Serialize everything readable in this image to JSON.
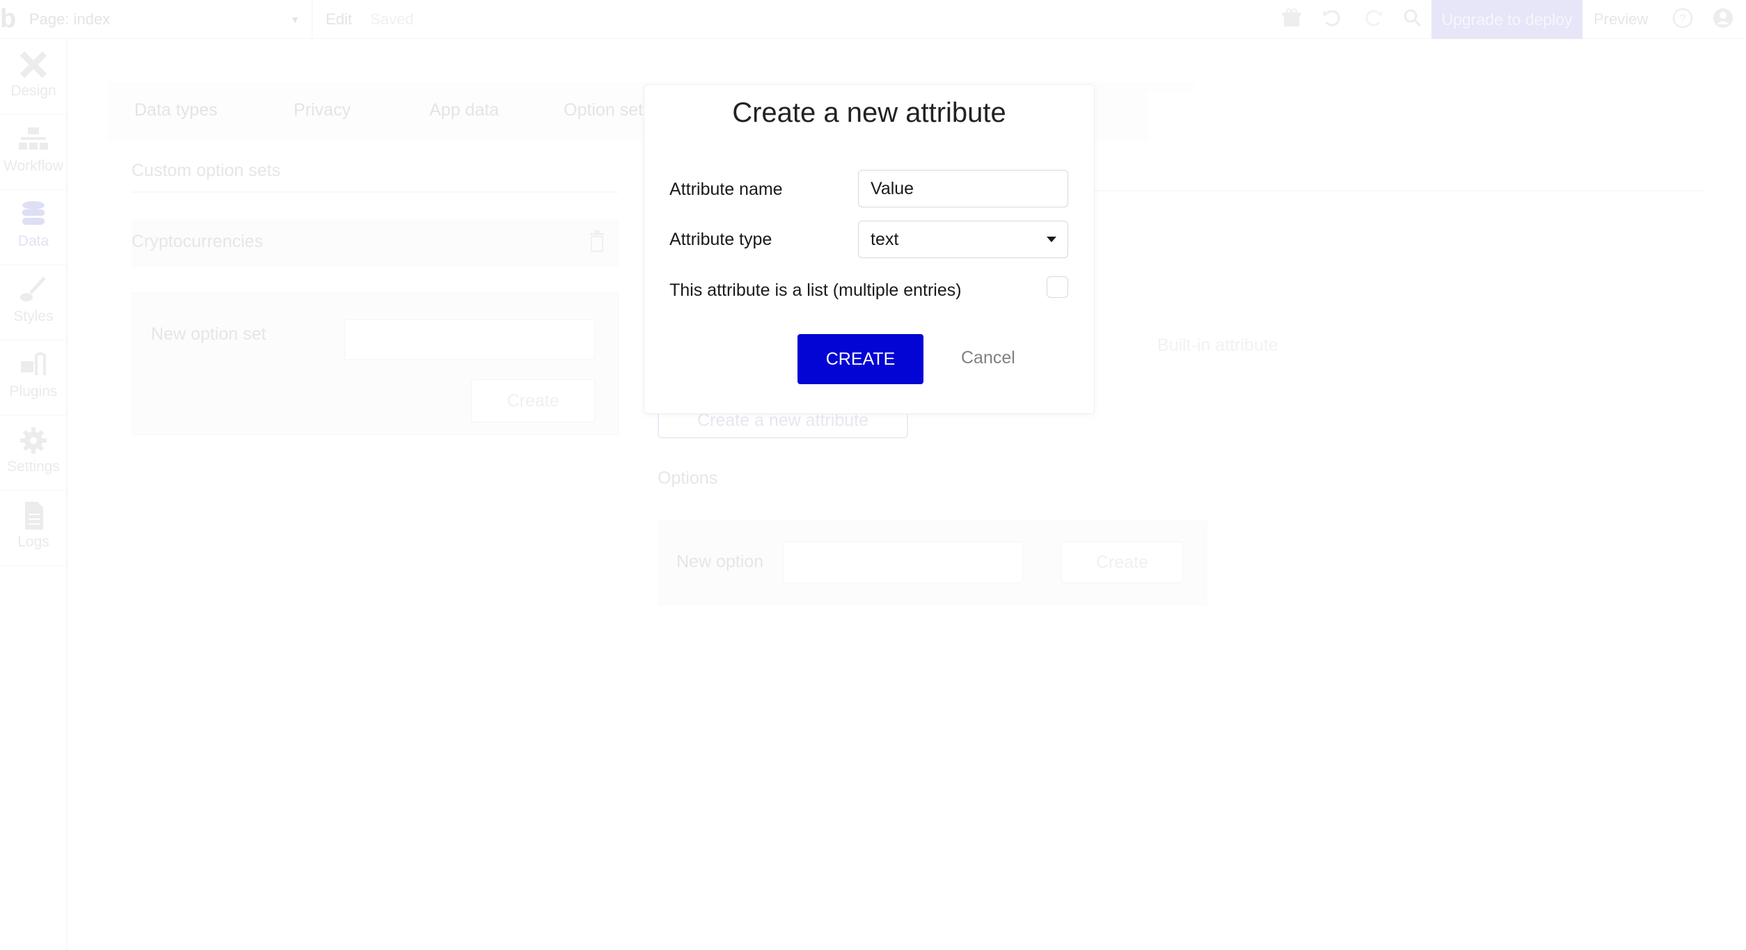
{
  "topbar": {
    "logo": "b",
    "page_selector": "Page: index",
    "edit_label": "Edit",
    "status": "Saved",
    "icons": [
      "gift-icon",
      "undo-icon",
      "redo-icon",
      "search-icon"
    ],
    "upgrade_label": "Upgrade to deploy",
    "preview_label": "Preview",
    "help_icon": "?",
    "account_icon": "user-icon"
  },
  "sidebar": {
    "items": [
      {
        "label": "Design",
        "icon": "design-icon"
      },
      {
        "label": "Workflow",
        "icon": "workflow-icon"
      },
      {
        "label": "Data",
        "icon": "database-icon",
        "active": true
      },
      {
        "label": "Styles",
        "icon": "brush-icon"
      },
      {
        "label": "Plugins",
        "icon": "plug-icon"
      },
      {
        "label": "Settings",
        "icon": "gear-icon"
      },
      {
        "label": "Logs",
        "icon": "document-icon"
      }
    ]
  },
  "data_tabs": [
    {
      "label": "Data types"
    },
    {
      "label": "Privacy"
    },
    {
      "label": "App data"
    },
    {
      "label": "Option sets",
      "active": true
    }
  ],
  "option_sets": {
    "section_title": "Custom option sets",
    "items": [
      {
        "name": "Cryptocurrencies"
      }
    ],
    "new_set_label": "New option set",
    "new_set_value": "",
    "create_label": "Create"
  },
  "option_set_detail": {
    "builtin_attribute_label": "Built-in attribute",
    "create_attribute_label": "Create a new attribute",
    "options_title": "Options",
    "new_option_label": "New option",
    "new_option_value": "",
    "create_label": "Create"
  },
  "modal": {
    "title": "Create a new attribute",
    "attribute_name_label": "Attribute name",
    "attribute_name_value": "Value",
    "attribute_type_label": "Attribute type",
    "attribute_type_value": "text",
    "is_list_label": "This attribute is a list (multiple entries)",
    "is_list_checked": false,
    "create_label": "CREATE",
    "cancel_label": "Cancel"
  },
  "colors": {
    "primary": "#0205d3",
    "upgrade_bg": "#e6e6f8",
    "cancel_text": "#808080"
  }
}
